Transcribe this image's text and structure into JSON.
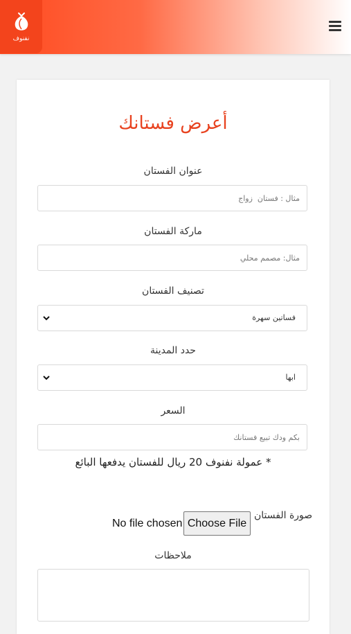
{
  "header": {
    "logo_text": "نفنوف",
    "brand_color": "#f3441c"
  },
  "form": {
    "title": "أعرض فستانك",
    "title_color": "#e8421f",
    "fields": {
      "dress_title": {
        "label": "عنوان الفستان",
        "placeholder": "مثال : فستان  زواج"
      },
      "dress_brand": {
        "label": "ماركة الفستان",
        "placeholder": "مثال: مصمم محلي"
      },
      "category": {
        "label": "تصنيف الفستان",
        "selected": "فساتين سهرة"
      },
      "city": {
        "label": "حدد المدينة",
        "selected": "ابها"
      },
      "price": {
        "label": "السعر",
        "placeholder": "بكم ودك تبيع فستانك"
      }
    },
    "commission_note": "* عمولة نفنوف 20 ريال للفستان يدفعها البائع",
    "image": {
      "label": "صورة الفستان",
      "button_label": "Choose File",
      "status": "No file chosen"
    },
    "notes": {
      "label": "ملاحظات",
      "value": ""
    }
  },
  "icons": {
    "logo": "onion-dress-logo-icon",
    "menu": "hamburger-menu-icon",
    "select_arrow": "chevron-down-icon"
  }
}
